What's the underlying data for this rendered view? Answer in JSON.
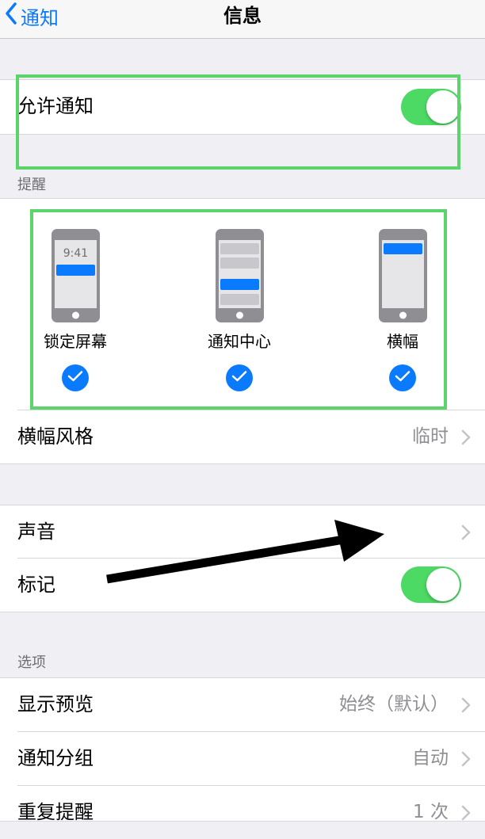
{
  "nav": {
    "back_label": "通知",
    "title": "信息"
  },
  "allow": {
    "label": "允许通知",
    "on": true
  },
  "alerts": {
    "header": "提醒",
    "lock_screen": {
      "time": "9:41",
      "label": "锁定屏幕",
      "checked": true
    },
    "notification_center": {
      "label": "通知中心",
      "checked": true
    },
    "banners": {
      "label": "横幅",
      "checked": true
    }
  },
  "banner_style": {
    "label": "横幅风格",
    "value": "临时"
  },
  "sounds": {
    "label": "声音"
  },
  "badges": {
    "label": "标记",
    "on": true
  },
  "options": {
    "header": "选项",
    "show_previews": {
      "label": "显示预览",
      "value": "始终（默认）"
    },
    "grouping": {
      "label": "通知分组",
      "value": "自动"
    },
    "repeat": {
      "label": "重复提醒",
      "value": "1 次"
    }
  },
  "colors": {
    "accent": "#0a7aff",
    "toggle_on": "#4cd964",
    "highlight": "#5dd46b"
  },
  "icons": [
    "chevron-left-icon",
    "checkmark-icon",
    "chevron-right-icon",
    "arrow-annotation"
  ]
}
